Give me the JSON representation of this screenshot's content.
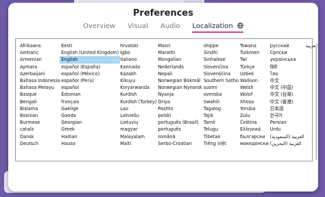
{
  "dialog": {
    "title": "Preferences",
    "tabs": [
      {
        "label": "Overview",
        "active": false
      },
      {
        "label": "Visual",
        "active": false
      },
      {
        "label": "Audio",
        "active": false
      },
      {
        "label": "Localization",
        "active": true
      }
    ],
    "active_tab_icon": "globe-icon"
  },
  "colors": {
    "accent": "#d33c8f",
    "selection": "#a9d7f5",
    "background": "#6d5aa8"
  },
  "languages": {
    "selected": "English",
    "columns": [
      [
        "Afrikaans",
        "Amharic",
        "Armenian",
        "Aymara",
        "Azerbaijani",
        "Bahasa Indonesia",
        "Bahasa Melayu",
        "Basque",
        "Bengali",
        "Bislama",
        "Bosnian",
        "Burmese",
        "català",
        "Dansk",
        "Deutsch"
      ],
      [
        "Eesti",
        "English (United Kingdom)",
        "English",
        "español (España)",
        "español (México)",
        "español (Perú)",
        "español",
        "Estonian",
        "français",
        "Gaeilge",
        "Ganda",
        "Georgian",
        "Greek",
        "Haitian",
        "Hausa"
      ],
      [
        "hrvatski",
        "Igbo",
        "italiano",
        "Kannada",
        "Kazakh",
        "Kikuyu",
        "Kinyarwanda",
        "Kurdish",
        "Kurdish (Turkey)",
        "Lao",
        "Latviešu",
        "Lietuvių",
        "magyar",
        "Malayalam",
        "Malti"
      ],
      [
        "Maori",
        "Marathi",
        "Mongolian",
        "Nederlands",
        "Nepali",
        "Norwegian Bokmål",
        "Norwegian Nynorsk",
        "Nyanja",
        "Oriya",
        "Pashto",
        "polski",
        "português (Brasil)",
        "português",
        "română",
        "Serbo-Croatian"
      ],
      [
        "shqipe",
        "Sindhi",
        "Sinhalese",
        "Slovenčina",
        "Slovenščina",
        "Southern Sotho",
        "suomi",
        "svenska",
        "Swahili",
        "Tagalog",
        "Tajik",
        "Tamil",
        "Telugu",
        "Tibetan",
        "Tiếng Việt"
      ],
      [
        "Tswana",
        "Turkmen",
        "Twi",
        "Türkçe",
        "Uzbek",
        "Walloon",
        "Welsh",
        "Wolof",
        "Xhosa",
        "Yoruba",
        "Zulu",
        "Čeština",
        "Ελληνικά",
        "български",
        "македонски"
      ],
      [
        "русский",
        "Српски",
        "українська",
        "हिंदी",
        "ไทย",
        "中文",
        "中文 (中国)",
        "中文 (台灣)",
        "中文 (香港)",
        "日本語",
        "한국어",
        "Persian",
        "Urdu",
        "العربية (السعودية)",
        "العربية (البحرين)"
      ],
      [
        "العربية"
      ]
    ]
  }
}
